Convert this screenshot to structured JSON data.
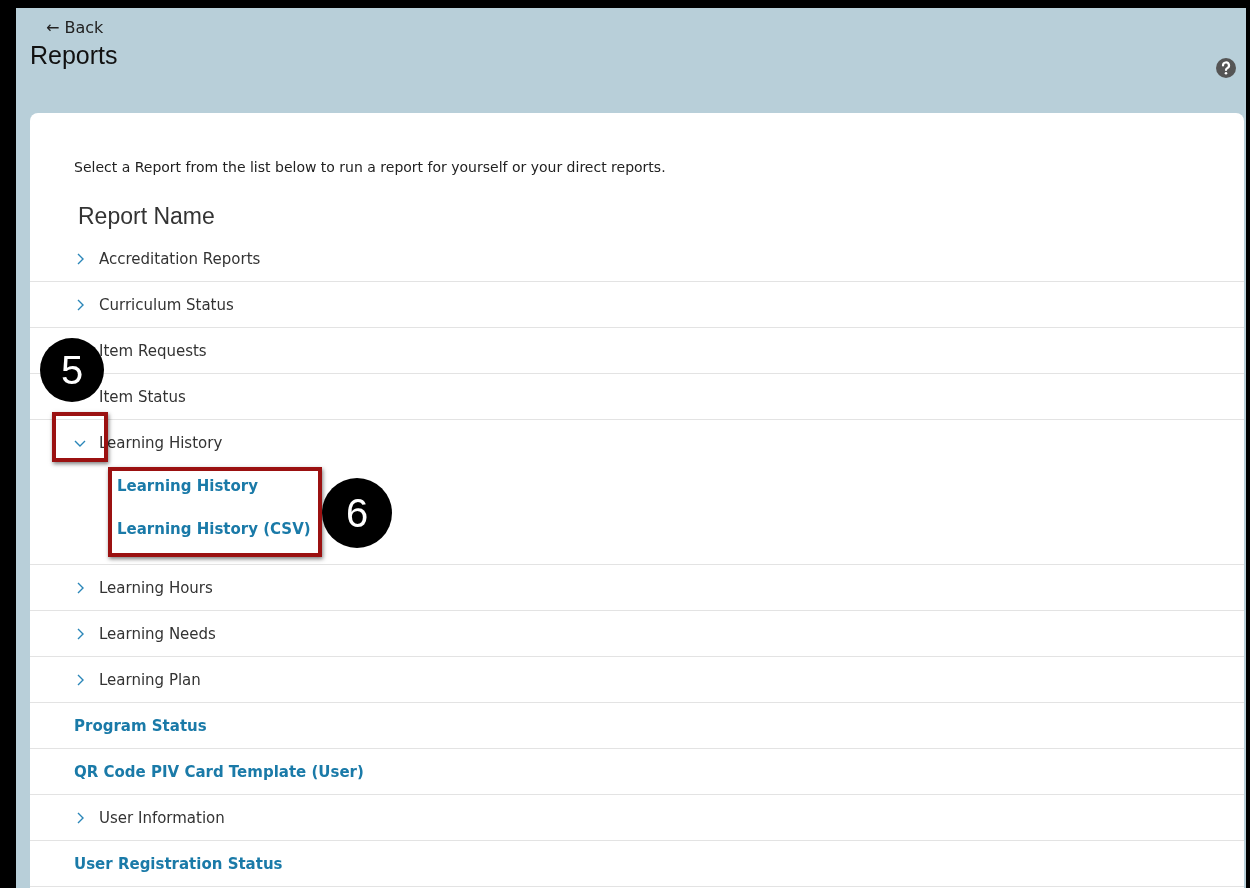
{
  "header": {
    "back_link": "← Back",
    "title": "Reports"
  },
  "intro": "Select a Report from the list below to run a report for yourself or your direct reports.",
  "list_heading": "Report Name",
  "reports": [
    {
      "kind": "group",
      "label": "Accreditation Reports",
      "expanded": false
    },
    {
      "kind": "group",
      "label": "Curriculum Status",
      "expanded": false
    },
    {
      "kind": "group",
      "label": "Item Requests"
    },
    {
      "kind": "group",
      "label": "Item Status"
    },
    {
      "kind": "group",
      "label": "Learning History",
      "expanded": true,
      "children": [
        "Learning History",
        "Learning History (CSV)"
      ]
    },
    {
      "kind": "group",
      "label": "Learning Hours",
      "expanded": false
    },
    {
      "kind": "group",
      "label": "Learning Needs",
      "expanded": false
    },
    {
      "kind": "group",
      "label": "Learning Plan",
      "expanded": false
    },
    {
      "kind": "link",
      "label": "Program Status"
    },
    {
      "kind": "link",
      "label": "QR Code PIV Card Template (User)"
    },
    {
      "kind": "group",
      "label": "User Information",
      "expanded": false
    },
    {
      "kind": "link",
      "label": "User Registration Status"
    }
  ],
  "callouts": [
    {
      "label": "5"
    },
    {
      "label": "6"
    }
  ]
}
